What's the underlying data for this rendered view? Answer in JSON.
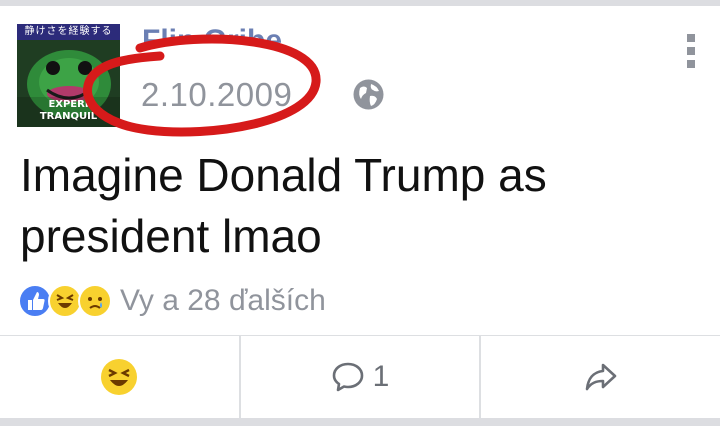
{
  "post": {
    "author": "Flip Gribe",
    "date": "2.10.2009",
    "text": "Imagine Donald Trump as president lmao",
    "avatar": {
      "top_text": "静けさを経験する",
      "bottom_text_1": "EXPERI",
      "bottom_text_2": "TRANQUIL"
    },
    "privacy_icon": "globe-icon",
    "menu_icon": "vertical-dots-icon"
  },
  "reactions": {
    "icons": [
      "like-icon",
      "haha-icon",
      "sad-icon"
    ],
    "summary": "Vy a 28 ďalších"
  },
  "actions": {
    "react_icon": "haha-icon",
    "comment_count": "1",
    "share_icon": "share-icon"
  },
  "colors": {
    "like_blue": "#4a7ef3",
    "emoji_yellow": "#f8d12f",
    "annotation_red": "#d61a1a",
    "muted_text": "#90949c"
  }
}
